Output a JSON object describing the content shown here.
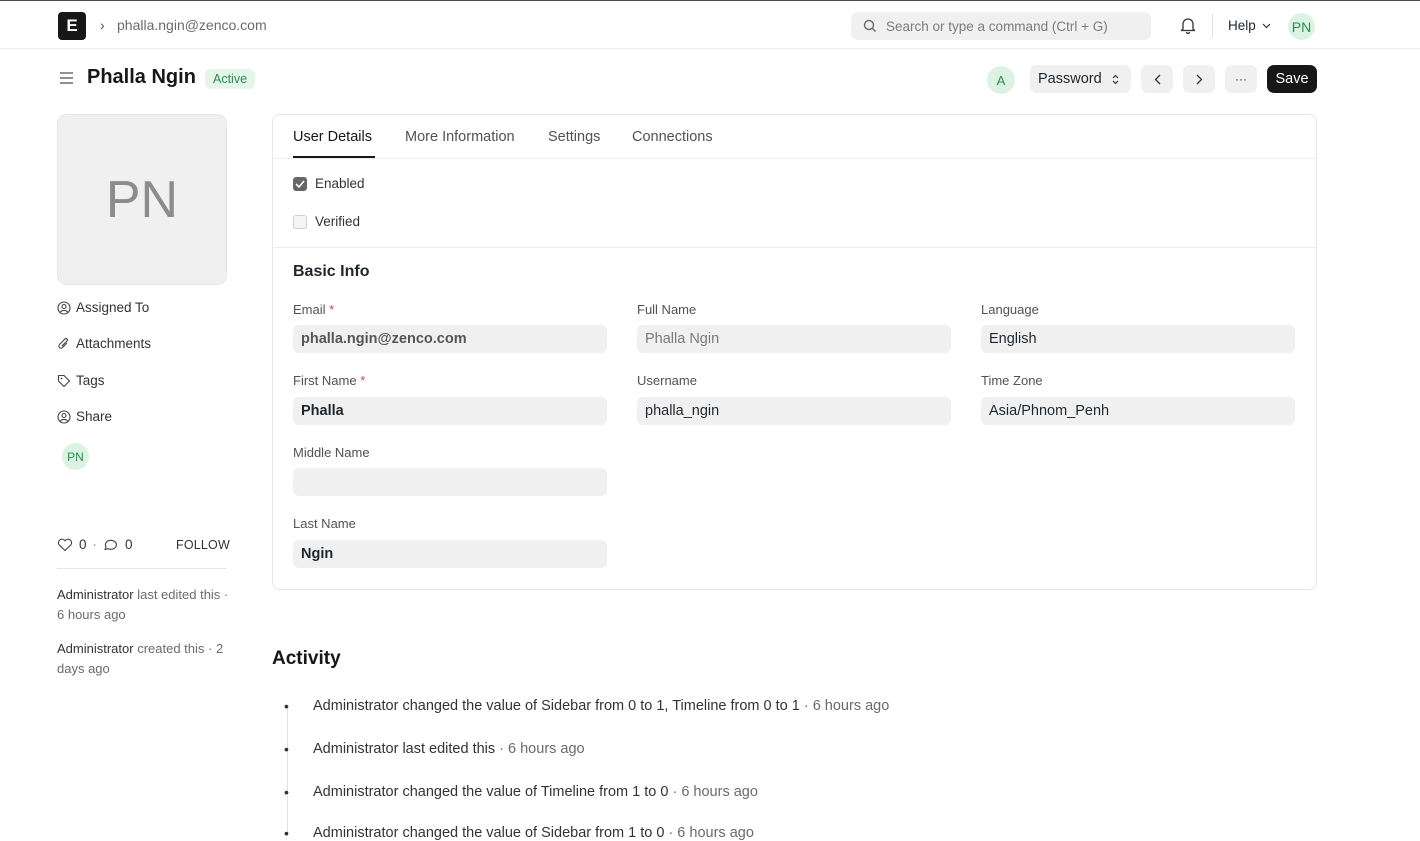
{
  "header": {
    "breadcrumb": "phalla.ngin@zenco.com",
    "search_placeholder": "Search or type a command (Ctrl + G)",
    "help_label": "Help",
    "user_initials": "PN",
    "logo_letter": "E"
  },
  "title_bar": {
    "title": "Phalla Ngin",
    "status": "Active",
    "assign_initial": "A",
    "password_label": "Password",
    "save_label": "Save",
    "more_label": "···"
  },
  "sidebar": {
    "avatar_initials": "PN",
    "assigned_to": "Assigned To",
    "attachments": "Attachments",
    "tags": "Tags",
    "share": "Share",
    "shared_initials": "PN",
    "likes": "0",
    "comments": "0",
    "follow": "FOLLOW",
    "last_edited_user": "Administrator",
    "last_edited_text": "last edited this · 6 hours ago",
    "created_user": "Administrator",
    "created_text": "created this · 2 days ago"
  },
  "tabs": [
    "User Details",
    "More Information",
    "Settings",
    "Connections"
  ],
  "checks": {
    "enabled_label": "Enabled",
    "enabled": true,
    "verified_label": "Verified",
    "verified": false
  },
  "basic_info": {
    "title": "Basic Info",
    "email_label": "Email",
    "email": "phalla.ngin@zenco.com",
    "full_name_label": "Full Name",
    "full_name": "Phalla Ngin",
    "language_label": "Language",
    "language": "English",
    "first_name_label": "First Name",
    "first_name": "Phalla",
    "username_label": "Username",
    "username": "phalla_ngin",
    "time_zone_label": "Time Zone",
    "time_zone": "Asia/Phnom_Penh",
    "middle_name_label": "Middle Name",
    "middle_name": "",
    "last_name_label": "Last Name",
    "last_name": "Ngin",
    "required_mark": "*"
  },
  "activity": {
    "title": "Activity",
    "items": [
      {
        "text": "Administrator changed the value of Sidebar from 0 to 1, Timeline from 0 to 1",
        "time": "· 6 hours ago"
      },
      {
        "text": "Administrator last edited this",
        "time": "· 6 hours ago"
      },
      {
        "text": "Administrator changed the value of Timeline from 1 to 0",
        "time": "· 6 hours ago"
      },
      {
        "text": "Administrator changed the value of Sidebar from 1 to 0",
        "time": "· 6 hours ago"
      }
    ]
  }
}
